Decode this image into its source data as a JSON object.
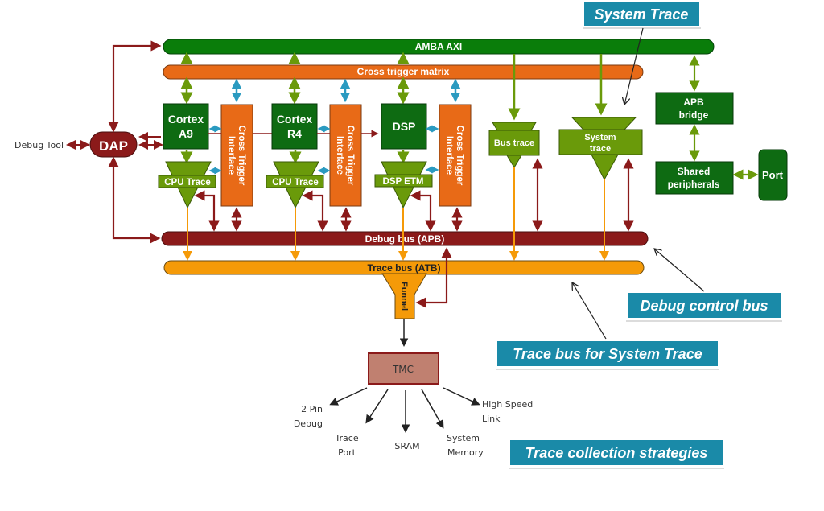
{
  "colors": {
    "axi_green": "#0a7d0a",
    "dark_green": "#0e6b12",
    "light_green": "#6a9a0a",
    "orange": "#e86a17",
    "dark_red": "#8b1a1a",
    "trace_orange": "#f59a08",
    "callout_blue": "#1a8aa8",
    "cyan_arrow": "#2a9ac0",
    "tmc_fill": "#c08070"
  },
  "buses": {
    "amba_axi": "AMBA AXI",
    "cross_trigger_matrix": "Cross trigger matrix",
    "debug_bus": "Debug bus (APB)",
    "trace_bus": "Trace bus (ATB)"
  },
  "external": {
    "debug_tool": "Debug Tool",
    "dap": "DAP"
  },
  "cores": [
    {
      "line1": "Cortex",
      "line2": "A9",
      "trace": "CPU Trace",
      "cti": [
        "Cross Trigger",
        "Interface"
      ]
    },
    {
      "line1": "Cortex",
      "line2": "R4",
      "trace": "CPU Trace",
      "cti": [
        "Cross Trigger",
        "Interface"
      ]
    },
    {
      "line1": "DSP",
      "line2": "",
      "trace": "DSP ETM",
      "cti": [
        "Cross Trigger",
        "Interface"
      ]
    }
  ],
  "system_blocks": {
    "bus_trace": "Bus trace",
    "system_trace_line1": "System",
    "system_trace_line2": "trace",
    "apb_bridge_line1": "APB",
    "apb_bridge_line2": "bridge",
    "shared_line1": "Shared",
    "shared_line2": "peripherals",
    "port": "Port"
  },
  "funnel": "Funnel",
  "tmc": {
    "label": "TMC",
    "outputs": [
      {
        "line1": "2 Pin",
        "line2": "Debug"
      },
      {
        "line1": "Trace",
        "line2": "Port"
      },
      {
        "line1": "SRAM",
        "line2": ""
      },
      {
        "line1": "System",
        "line2": "Memory"
      },
      {
        "line1": "High Speed",
        "line2": "Link"
      }
    ]
  },
  "callouts": {
    "system_trace": "System Trace",
    "debug_control_bus": "Debug control bus",
    "trace_bus_system": "Trace bus for System Trace",
    "trace_collection": "Trace collection strategies"
  }
}
